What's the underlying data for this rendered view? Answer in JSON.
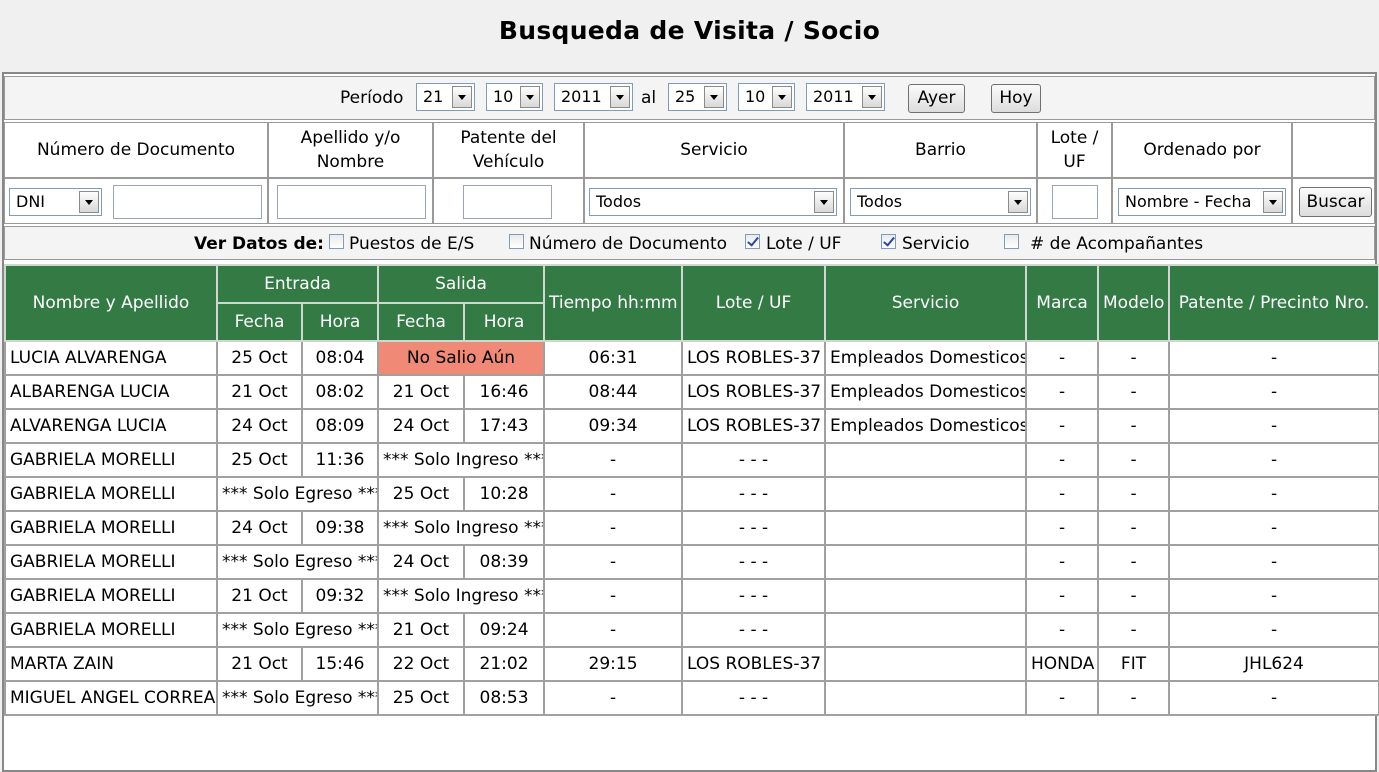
{
  "title": "Busqueda de Visita / Socio",
  "period": {
    "label": "Período",
    "from": {
      "day": "21",
      "month": "10",
      "year": "2011"
    },
    "separator": "al",
    "to": {
      "day": "25",
      "month": "10",
      "year": "2011"
    },
    "yesterday_label": "Ayer",
    "today_label": "Hoy"
  },
  "search": {
    "headers": {
      "document": "Número de Documento",
      "name": "Apellido y/o Nombre",
      "plate": "Patente del Vehículo",
      "service": "Servicio",
      "neighborhood": "Barrio",
      "lot": "Lote / UF",
      "order": "Ordenado por"
    },
    "doc_type": "DNI",
    "doc_number": "",
    "name_value": "",
    "plate_value": "",
    "service_value": "Todos",
    "neighborhood_value": "Todos",
    "lot_value": "",
    "order_value": "Nombre - Fecha",
    "search_label": "Buscar"
  },
  "view": {
    "label": "Ver Datos de:",
    "options": [
      {
        "label": "Puestos de E/S",
        "checked": false
      },
      {
        "label": "Número de Documento",
        "checked": false
      },
      {
        "label": "Lote / UF",
        "checked": true
      },
      {
        "label": "Servicio",
        "checked": true
      },
      {
        "label": "# de Acompañantes",
        "checked": false
      }
    ]
  },
  "results": {
    "headers": {
      "name": "Nombre y Apellido",
      "entry": "Entrada",
      "exit": "Salida",
      "date": "Fecha",
      "hour": "Hora",
      "time": "Tiempo hh:mm",
      "lot": "Lote / UF",
      "service": "Servicio",
      "brand": "Marca",
      "model": "Modelo",
      "plate": "Patente / Precinto Nro."
    },
    "rows": [
      {
        "name": "LUCIA ALVARENGA",
        "in_date": "25 Oct",
        "in_hour": "08:04",
        "out_merged": "No Salio Aún",
        "out_status": "pending",
        "time": "06:31",
        "lot": "LOS ROBLES-37",
        "service": "Empleados Domesticos",
        "brand": "-",
        "model": "-",
        "plate": "-"
      },
      {
        "name": "ALBARENGA LUCIA",
        "in_date": "21 Oct",
        "in_hour": "08:02",
        "out_date": "21 Oct",
        "out_hour": "16:46",
        "time": "08:44",
        "lot": "LOS ROBLES-37",
        "service": "Empleados Domesticos",
        "brand": "-",
        "model": "-",
        "plate": "-"
      },
      {
        "name": "ALVARENGA LUCIA",
        "in_date": "24 Oct",
        "in_hour": "08:09",
        "out_date": "24 Oct",
        "out_hour": "17:43",
        "time": "09:34",
        "lot": "LOS ROBLES-37",
        "service": "Empleados Domesticos",
        "brand": "-",
        "model": "-",
        "plate": "-"
      },
      {
        "name": "GABRIELA MORELLI",
        "in_date": "25 Oct",
        "in_hour": "11:36",
        "out_merged": "*** Solo Ingreso ***",
        "time": "-",
        "lot": "- - -",
        "service": "",
        "brand": "-",
        "model": "-",
        "plate": "-"
      },
      {
        "name": "GABRIELA MORELLI",
        "in_merged": "*** Solo Egreso ***",
        "out_date": "25 Oct",
        "out_hour": "10:28",
        "time": "-",
        "lot": "- - -",
        "service": "",
        "brand": "-",
        "model": "-",
        "plate": "-"
      },
      {
        "name": "GABRIELA MORELLI",
        "in_date": "24 Oct",
        "in_hour": "09:38",
        "out_merged": "*** Solo Ingreso ***",
        "time": "-",
        "lot": "- - -",
        "service": "",
        "brand": "-",
        "model": "-",
        "plate": "-"
      },
      {
        "name": "GABRIELA MORELLI",
        "in_merged": "*** Solo Egreso ***",
        "out_date": "24 Oct",
        "out_hour": "08:39",
        "time": "-",
        "lot": "- - -",
        "service": "",
        "brand": "-",
        "model": "-",
        "plate": "-"
      },
      {
        "name": "GABRIELA MORELLI",
        "in_date": "21 Oct",
        "in_hour": "09:32",
        "out_merged": "*** Solo Ingreso ***",
        "time": "-",
        "lot": "- - -",
        "service": "",
        "brand": "-",
        "model": "-",
        "plate": "-"
      },
      {
        "name": "GABRIELA MORELLI",
        "in_merged": "*** Solo Egreso ***",
        "out_date": "21 Oct",
        "out_hour": "09:24",
        "time": "-",
        "lot": "- - -",
        "service": "",
        "brand": "-",
        "model": "-",
        "plate": "-"
      },
      {
        "name": "MARTA ZAIN",
        "in_date": "21 Oct",
        "in_hour": "15:46",
        "out_date": "22 Oct",
        "out_hour": "21:02",
        "time": "29:15",
        "lot": "LOS ROBLES-37",
        "service": "",
        "brand": "HONDA",
        "model": "FIT",
        "plate": "JHL624"
      },
      {
        "name": "MIGUEL ANGEL CORREA",
        "in_merged": "*** Solo Egreso ***",
        "out_date": "25 Oct",
        "out_hour": "08:53",
        "time": "-",
        "lot": "- - -",
        "service": "",
        "brand": "-",
        "model": "-",
        "plate": "-"
      }
    ]
  },
  "colors": {
    "header_green": "#337a45",
    "pending_red": "#f08a77"
  }
}
